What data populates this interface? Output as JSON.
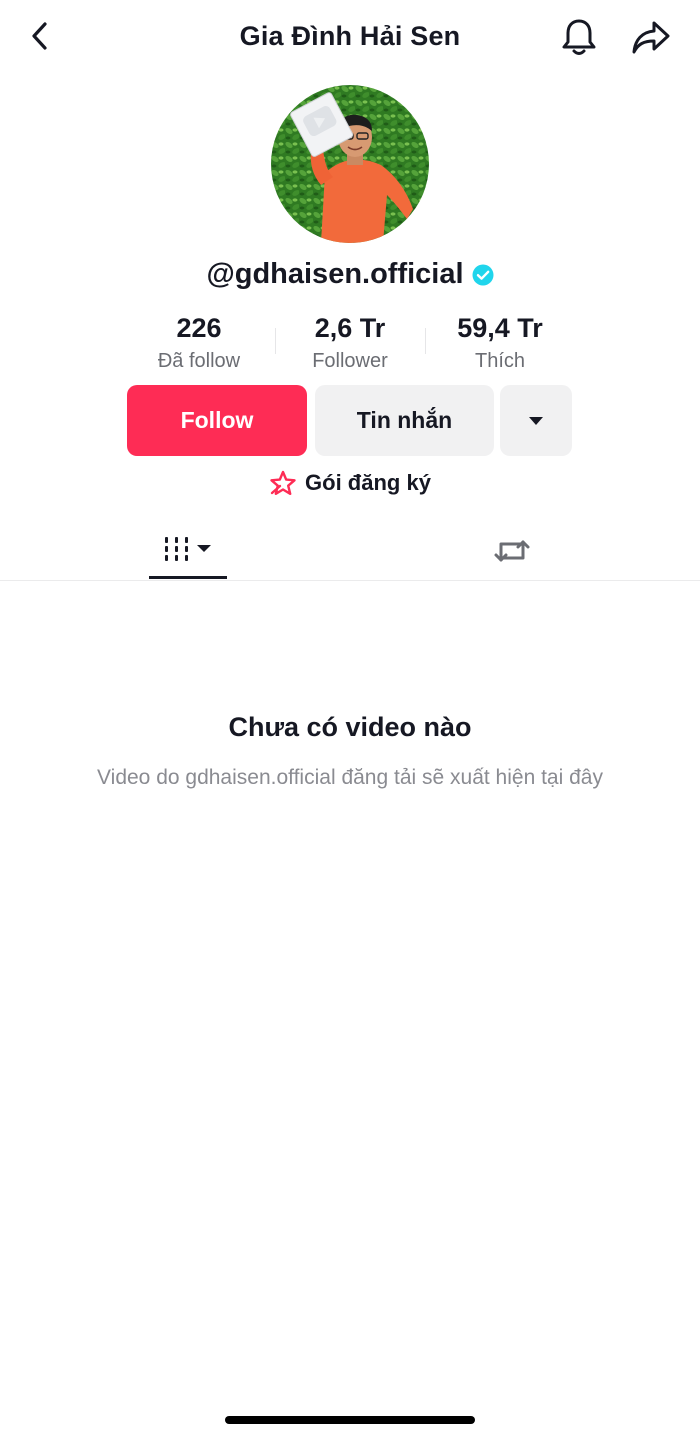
{
  "header": {
    "title": "Gia Đình Hải Sen",
    "back_icon": "chevron-left-icon",
    "notification_icon": "bell-icon",
    "share_icon": "share-arrow-icon"
  },
  "profile": {
    "avatar_icon": "avatar",
    "username": "@gdhaisen.official",
    "verified_icon": "verified-badge-icon",
    "verified_color": "#20d5ec"
  },
  "stats": [
    {
      "value": "226",
      "label": "Đã follow"
    },
    {
      "value": "2,6 Tr",
      "label": "Follower"
    },
    {
      "value": "59,4 Tr",
      "label": "Thích"
    }
  ],
  "actions": {
    "follow_label": "Follow",
    "follow_color": "#fe2c55",
    "message_label": "Tin nhắn",
    "more_icon": "caret-down-icon"
  },
  "subscription": {
    "label": "Gói đăng ký",
    "icon": "star-badge-icon",
    "icon_color": "#fe2c55"
  },
  "tabs": {
    "videos_icon": "grid-bars-icon",
    "reposts_icon": "repost-icon"
  },
  "empty_state": {
    "title": "Chưa có video nào",
    "description": "Video do gdhaisen.official đăng tải sẽ xuất hiện tại đây"
  }
}
